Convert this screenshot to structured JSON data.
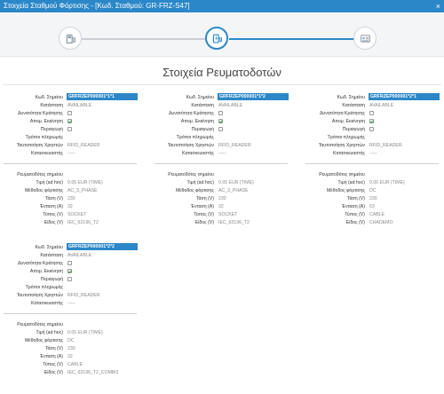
{
  "window": {
    "title": "Στοιχεία Σταθμού Φόρτισης - [Κωδ. Σταθμού: GR-FRZ-S47]",
    "close_icon": "×"
  },
  "steps": [
    {
      "icon": "station-icon",
      "active": false
    },
    {
      "icon": "charger-plug-icon",
      "active": true
    },
    {
      "icon": "document-icon",
      "active": false
    }
  ],
  "page_title": "Στοιχεία Ρευματοδοτών",
  "labels": {
    "code": "Κωδ. Σημείου",
    "status": "Κατάσταση",
    "reservable": "Δυνατότητα Κράτησης",
    "remote_start": "Απομ. Εκκίνηση",
    "roaming": "Περιαγωγή",
    "payment": "Τρόποι πληρωμής",
    "user_auth": "Ταυτοποίηση Χρηστών",
    "manufacturer": "Κατασκευαστής",
    "outlets": "Ρευματοδότες σημείου",
    "price": "Τιμή (ad hoc)",
    "method": "Μέθοδος φόρτισης",
    "voltage": "Τάση (V)",
    "current": "Ένταση (A)",
    "type": "Τύπος (V)",
    "kind": "Είδος (V)"
  },
  "points": [
    {
      "code": "GRFRZEP000001*1*1",
      "status": "AVAILABLE",
      "reservable": false,
      "remote_start": true,
      "roaming": false,
      "payment": "",
      "user_auth": "RFID_READER",
      "manufacturer": "-----",
      "outlets": "",
      "price": "0.05 EUR (TIME)",
      "method": "AC_3_PHASE",
      "voltage": "230",
      "current": "32",
      "type": "SOCKET",
      "kind": "IEC_62196_T2"
    },
    {
      "code": "GRFRZEP000001*1*2",
      "status": "AVAILABLE",
      "reservable": false,
      "remote_start": true,
      "roaming": false,
      "payment": "",
      "user_auth": "RFID_READER",
      "manufacturer": "-----",
      "outlets": "",
      "price": "0.05 EUR (TIME)",
      "method": "AC_3_PHASE",
      "voltage": "230",
      "current": "32",
      "type": "SOCKET",
      "kind": "IEC_62196_T2"
    },
    {
      "code": "GRFRZEP000001*2*1",
      "status": "AVAILABLE",
      "reservable": false,
      "remote_start": true,
      "roaming": false,
      "payment": "",
      "user_auth": "RFID_READER",
      "manufacturer": "-----",
      "outlets": "",
      "price": "0.05 EUR (TIME)",
      "method": "DC",
      "voltage": "230",
      "current": "63",
      "type": "CABLE",
      "kind": "CHADEMO"
    },
    {
      "code": "GRFRZEP000001*2*2",
      "status": "AVAILABLE",
      "reservable": false,
      "remote_start": true,
      "roaming": false,
      "payment": "",
      "user_auth": "RFID_READER",
      "manufacturer": "-----",
      "outlets": "",
      "price": "0.05 EUR (TIME)",
      "method": "DC",
      "voltage": "230",
      "current": "32",
      "type": "CABLE",
      "kind": "IEC_62196_T2_COMBO"
    }
  ]
}
